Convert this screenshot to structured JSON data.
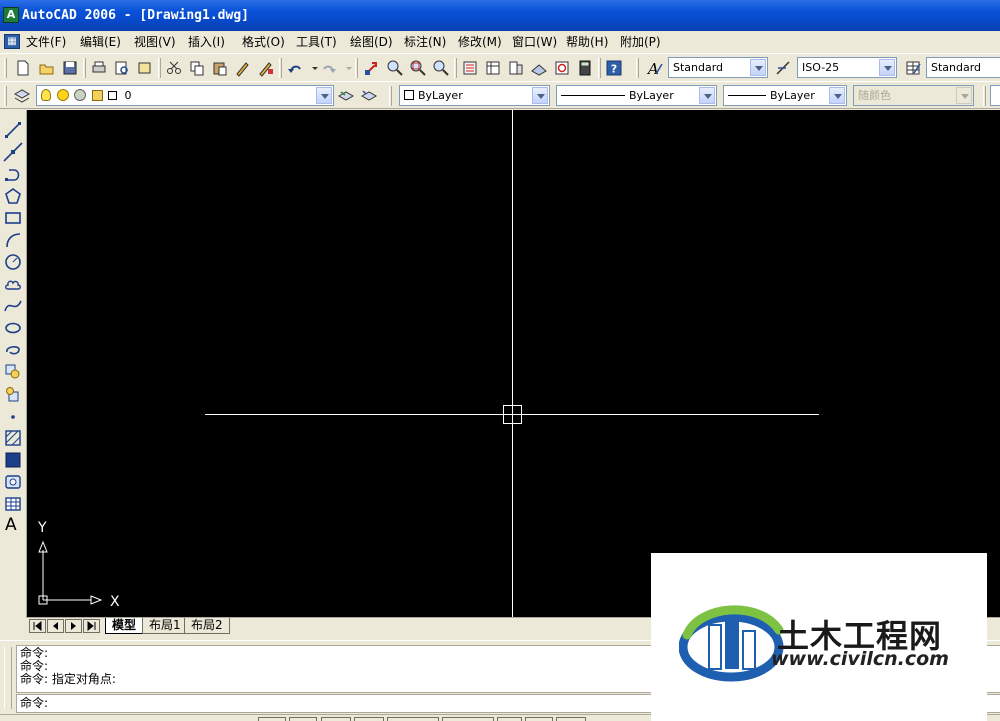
{
  "window": {
    "title": "AutoCAD 2006 - [Drawing1.dwg]",
    "app_icon_glyph": "A"
  },
  "menu": {
    "items": [
      {
        "label": "文件(F)"
      },
      {
        "label": "编辑(E)"
      },
      {
        "label": "视图(V)"
      },
      {
        "label": "插入(I)"
      },
      {
        "label": "格式(O)"
      },
      {
        "label": "工具(T)"
      },
      {
        "label": "绘图(D)"
      },
      {
        "label": "标注(N)"
      },
      {
        "label": "修改(M)"
      },
      {
        "label": "窗口(W)"
      },
      {
        "label": "帮助(H)"
      },
      {
        "label": "附加(P)"
      }
    ]
  },
  "styles_toolbar": {
    "text_style": "Standard",
    "dim_style": "ISO-25",
    "table_style": "Standard"
  },
  "layers_toolbar": {
    "current_layer": "0",
    "color": "ByLayer",
    "linetype": "ByLayer",
    "lineweight": "ByLayer",
    "plot_style": "随颜色"
  },
  "canvas": {
    "background": "#000000",
    "crosshair_color": "#ffffff",
    "ucs_x_label": "X",
    "ucs_y_label": "Y"
  },
  "layout_tabs": [
    {
      "label": "模型",
      "active": true
    },
    {
      "label": "布局1",
      "active": false
    },
    {
      "label": "布局2",
      "active": false
    }
  ],
  "command": {
    "history": [
      "命令:",
      "命令:",
      "命令: 指定对角点:"
    ],
    "prompt": "命令:"
  },
  "left_tools": [
    "line-icon",
    "construction-line-icon",
    "polyline-icon",
    "polygon-icon",
    "rectangle-icon",
    "arc-icon",
    "circle-icon",
    "revision-cloud-icon",
    "spline-icon",
    "ellipse-icon",
    "ellipse-arc-icon",
    "insert-block-icon",
    "make-block-icon",
    "point-icon",
    "hatch-icon",
    "gradient-icon",
    "region-icon",
    "table-icon",
    "multiline-text-icon"
  ],
  "left_tools_text_glyph": "A",
  "watermark": {
    "brand": "土木工程网",
    "url": "www.civilcn.com"
  }
}
